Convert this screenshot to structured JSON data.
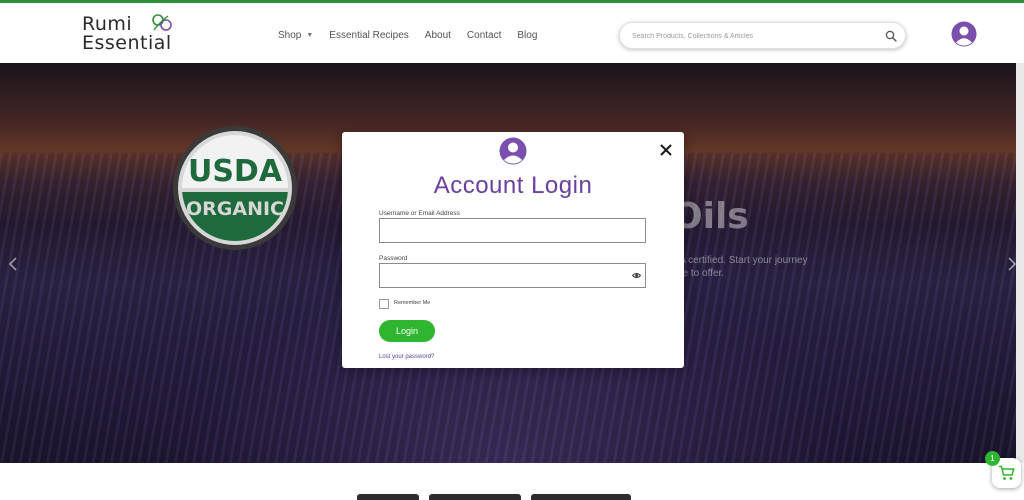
{
  "header": {
    "logo": {
      "line1": "Rumi",
      "line2": "Essential"
    },
    "nav": [
      {
        "label": "Shop",
        "has_dropdown": true
      },
      {
        "label": "Essential Recipes"
      },
      {
        "label": "About"
      },
      {
        "label": "Contact"
      },
      {
        "label": "Blog"
      }
    ],
    "search": {
      "placeholder": "Search Products, Collections & Articles",
      "icon": "search-icon"
    },
    "account_icon": "user-circle-icon"
  },
  "hero": {
    "badge": {
      "line1": "USDA",
      "line2": "ORGANIC"
    },
    "title_fragment": "Oils",
    "text_line1": "DA certified. Start your journey",
    "text_line2": "ave to offer.",
    "prev_icon": "chevron-left-icon",
    "next_icon": "chevron-right-icon"
  },
  "modal": {
    "title": "Account Login",
    "username_label": "Username or Email Address",
    "username_value": "",
    "password_label": "Password",
    "password_value": "",
    "remember_label": "Remember Me",
    "remember_checked": false,
    "login_button": "Login",
    "lost_password": "Lost your password?",
    "close_icon": "close-icon"
  },
  "cart": {
    "count": "1",
    "icon": "cart-icon"
  },
  "colors": {
    "brand_green": "#2fb52f",
    "modal_title": "#6a3fa0",
    "link": "#5a3f99",
    "topbar": "#2f8f3a",
    "icon_purple": "#7a4fae"
  }
}
